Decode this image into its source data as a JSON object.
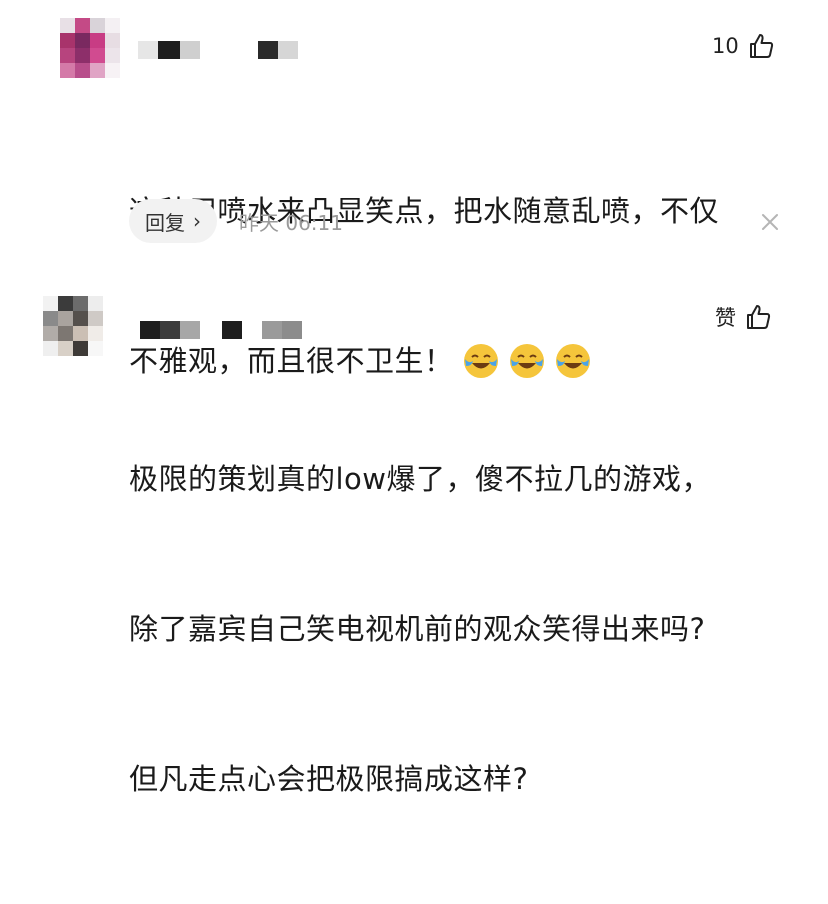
{
  "comments": [
    {
      "like_count": "10",
      "text_lines": [
        "这种用喷水来凸显笑点，把水随意乱喷，不仅",
        "不雅观，而且很不卫生！"
      ],
      "emoji": [
        "laugh-cry-emoji",
        "laugh-cry-emoji",
        "laugh-cry-emoji"
      ],
      "reply_label": "回复",
      "reply_chevron": "›",
      "timestamp": "昨天 06:11",
      "dismiss_icon": "close-icon"
    },
    {
      "like_label": "赞",
      "text_lines": [
        "极限的策划真的low爆了，傻不拉几的游戏，",
        "除了嘉宾自己笑电视机前的观众笑得出来吗?",
        "但凡走点心会把极限搞成这样?"
      ]
    }
  ],
  "colors": {
    "text": "#1a1a1a",
    "meta": "#9a9a9a",
    "reply_bg": "#f2f2f2",
    "emoji_face": "#f5c53b",
    "emoji_tears": "#4aa3e8"
  }
}
